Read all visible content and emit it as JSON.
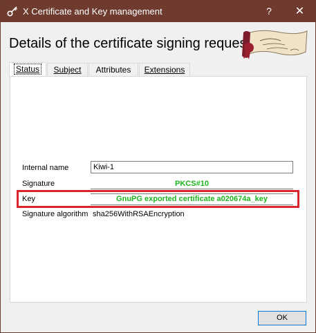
{
  "window": {
    "title": "X Certificate and Key management",
    "help_glyph": "?",
    "close_glyph": "✕",
    "titlebar_color": "#6f3b2f"
  },
  "dialog": {
    "heading": "Details of the certificate signing request",
    "logo_icon": "certificate-scroll-icon"
  },
  "tabs": [
    {
      "label": "Status",
      "active": true
    },
    {
      "label": "Subject",
      "active": false
    },
    {
      "label": "Attributes",
      "active": false
    },
    {
      "label": "Extensions",
      "active": false
    }
  ],
  "status": {
    "internal_name_label": "Internal name",
    "internal_name_value": "Kiwi-1",
    "signature_label": "Signature",
    "signature_value": "PKCS#10",
    "key_label": "Key",
    "key_value": "GnuPG exported certificate a020674a_key",
    "sig_algo_label": "Signature algorithm",
    "sig_algo_value": "sha256WithRSAEncryption"
  },
  "colors": {
    "ok_green": "#1cb51c",
    "highlight_red": "#d9262e",
    "focus_blue": "#0078d7"
  },
  "buttons": {
    "ok_label": "OK"
  }
}
